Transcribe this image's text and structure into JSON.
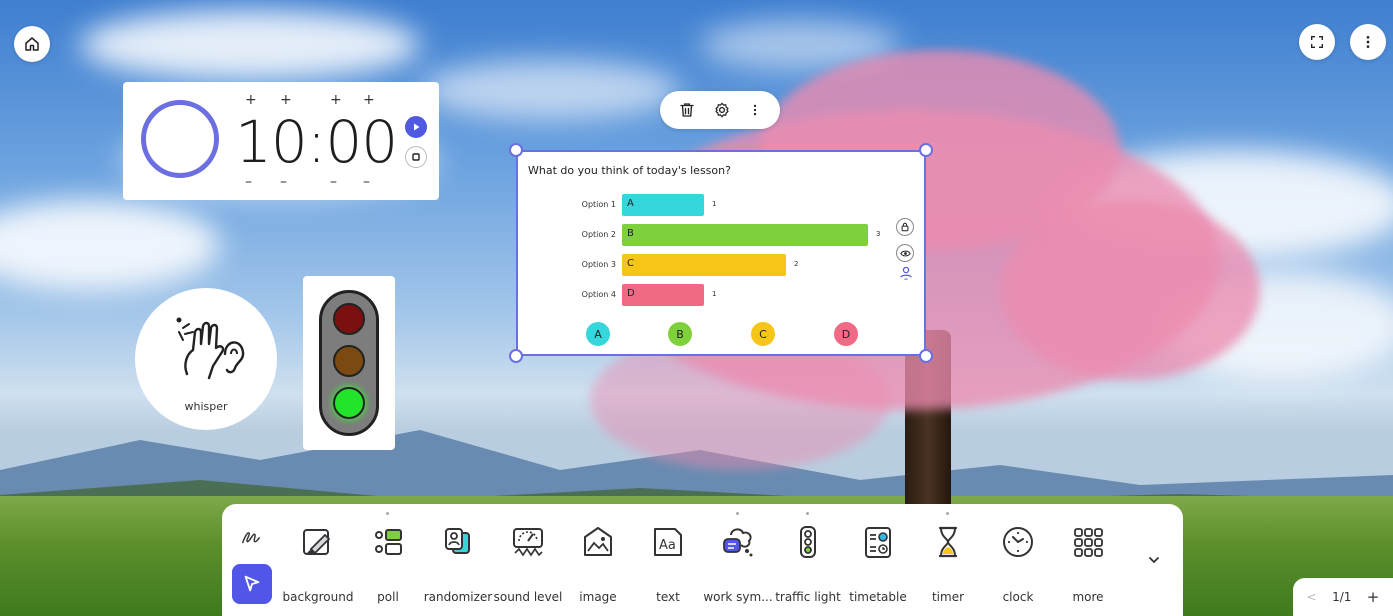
{
  "timer": {
    "time": "10:00",
    "increase_label": "+",
    "decrease_label": "–"
  },
  "whisper": {
    "label": "whisper"
  },
  "poll": {
    "question": "What do you think of today's lesson?",
    "options": [
      {
        "name": "Option 1",
        "letter": "A",
        "count": "1",
        "color": "#35d6dc"
      },
      {
        "name": "Option 2",
        "letter": "B",
        "count": "3",
        "color": "#7fd13b"
      },
      {
        "name": "Option 3",
        "letter": "C",
        "count": "2",
        "color": "#f5c518"
      },
      {
        "name": "Option 4",
        "letter": "D",
        "count": "1",
        "color": "#f06a86"
      }
    ]
  },
  "toolbar": {
    "tools": [
      {
        "label": "background",
        "icon": "background-icon"
      },
      {
        "label": "poll",
        "icon": "poll-icon"
      },
      {
        "label": "randomizer",
        "icon": "randomizer-icon"
      },
      {
        "label": "sound level",
        "icon": "sound-level-icon"
      },
      {
        "label": "image",
        "icon": "image-icon"
      },
      {
        "label": "text",
        "icon": "text-icon"
      },
      {
        "label": "work sym...",
        "icon": "work-symbol-icon"
      },
      {
        "label": "traffic light",
        "icon": "traffic-light-icon"
      },
      {
        "label": "timetable",
        "icon": "timetable-icon"
      },
      {
        "label": "timer",
        "icon": "hourglass-icon"
      },
      {
        "label": "clock",
        "icon": "clock-icon"
      },
      {
        "label": "more",
        "icon": "grid-icon"
      }
    ]
  },
  "pager": {
    "page": "1/1",
    "prev": "<",
    "add": "+"
  },
  "colors": {
    "accent": "#5256e8",
    "selection": "#6b6fe0"
  }
}
